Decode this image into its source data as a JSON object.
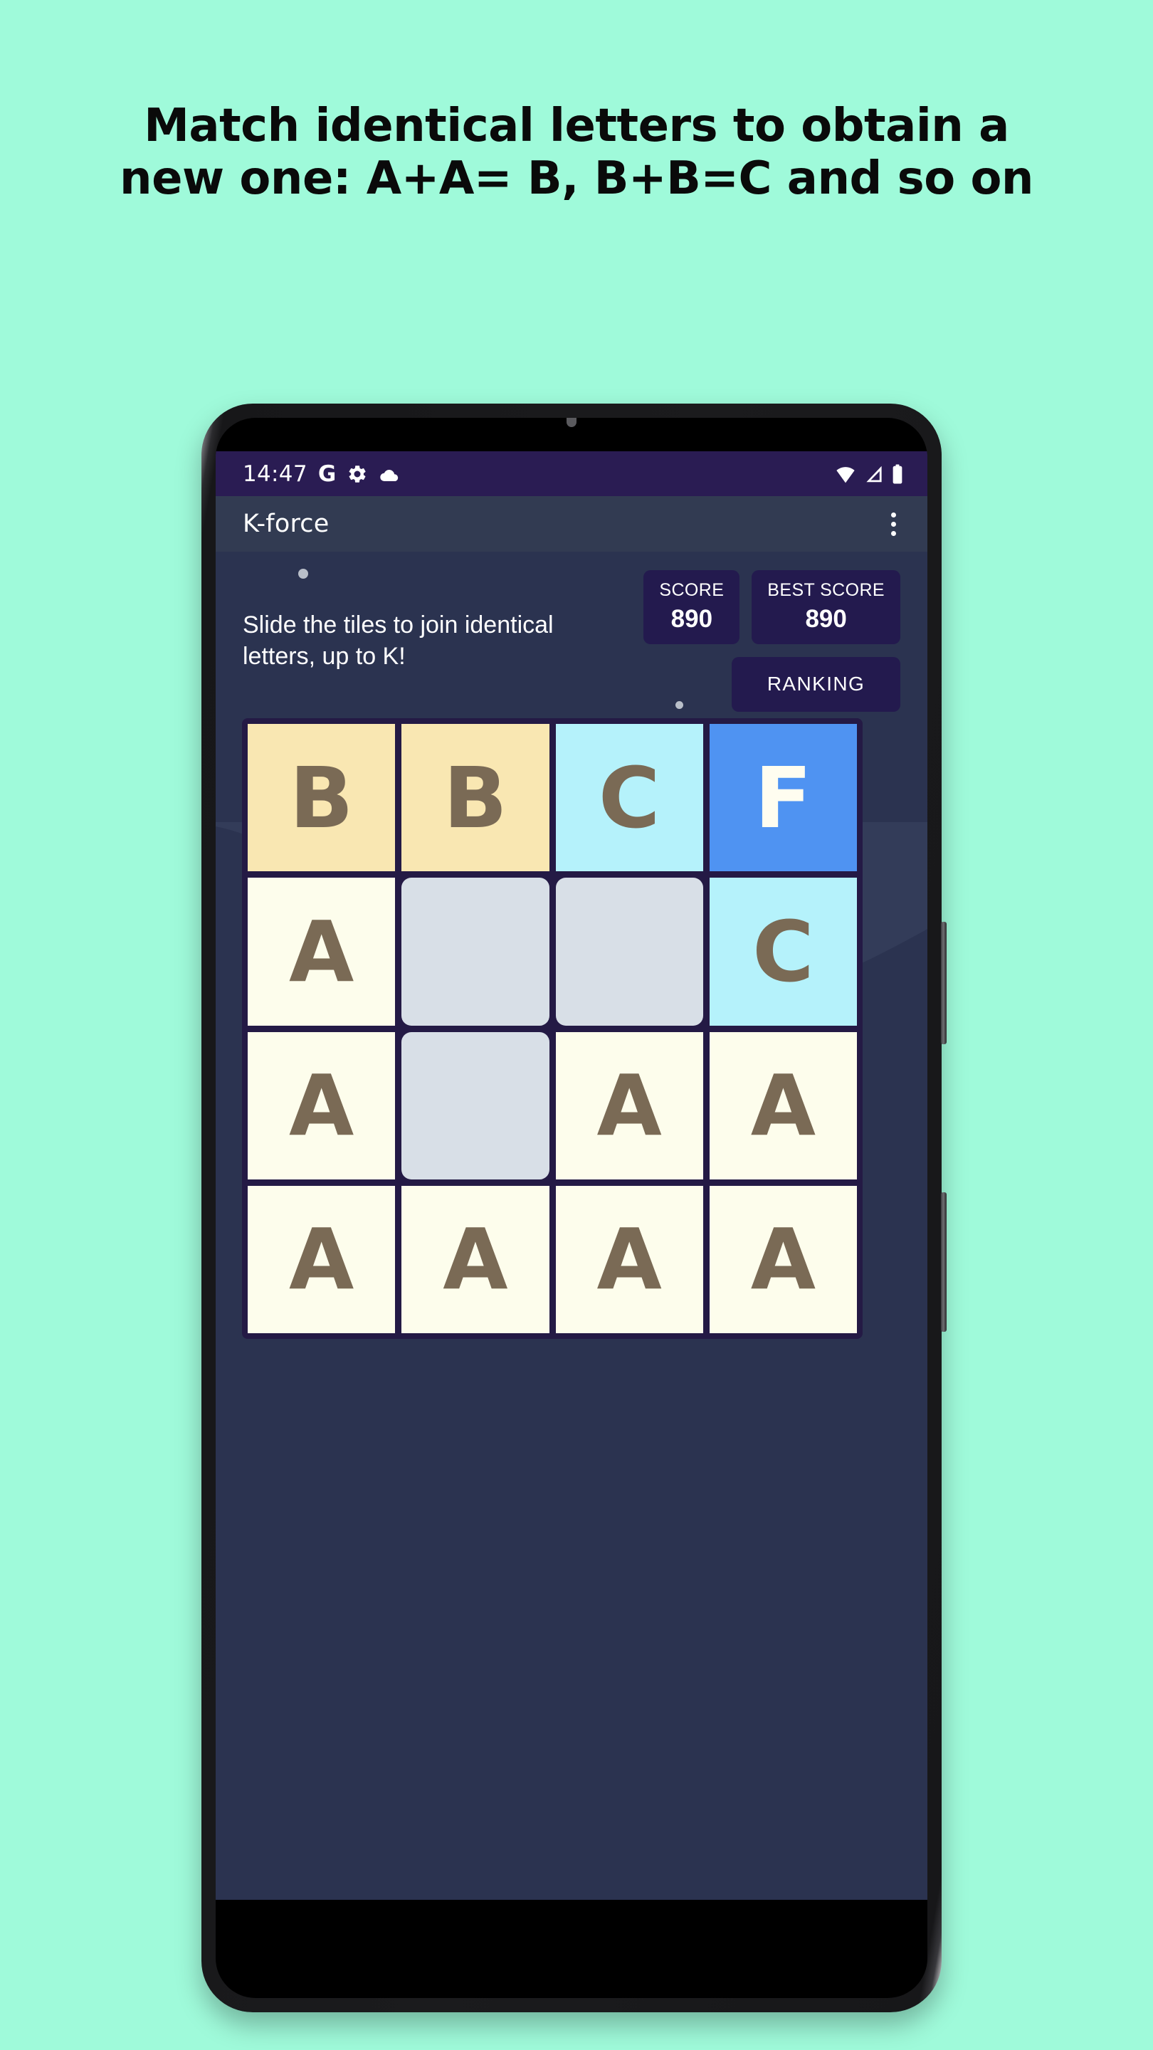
{
  "promo": {
    "line1": "Match identical letters to obtain a",
    "line2": "new one: A+A= B, B+B=C and so on",
    "background_color": "#9ffada",
    "text_color": "#0a0a0a"
  },
  "statusbar": {
    "time": "14:47",
    "google_glyph": "G",
    "icons_left": [
      "google-icon",
      "gear-icon",
      "cloud-icon"
    ],
    "icons_right": [
      "wifi-icon",
      "cellular-signal-icon",
      "battery-icon"
    ],
    "background_color": "#2a1c53"
  },
  "appbar": {
    "title": "K-force",
    "overflow_icon": "kebab-menu-icon",
    "background_color": "#323b52"
  },
  "main": {
    "instructions": "Slide the tiles to join identical letters, up to K!",
    "score": {
      "label": "SCORE",
      "value": "890"
    },
    "best_score": {
      "label": "BEST SCORE",
      "value": "890"
    },
    "ranking_button": "RANKING",
    "panel_color": "#2b3350",
    "score_box_color": "#231a4e"
  },
  "chart_data": {
    "type": "table",
    "title": "K-force 4x4 letter grid",
    "grid_background": "#241a45",
    "rows": 4,
    "cols": 4,
    "tiles": [
      {
        "letter": "B",
        "bg": "#f9e7b2",
        "fg": "#7a6a55"
      },
      {
        "letter": "B",
        "bg": "#f9e7b2",
        "fg": "#7a6a55"
      },
      {
        "letter": "C",
        "bg": "#b5f2fb",
        "fg": "#7a6a55"
      },
      {
        "letter": "F",
        "bg": "#4f93f2",
        "fg": "#fffdf0"
      },
      {
        "letter": "A",
        "bg": "#fdfdec",
        "fg": "#7a6a55"
      },
      {
        "letter": "",
        "bg": "#d8dfe7",
        "fg": "#d8dfe7"
      },
      {
        "letter": "",
        "bg": "#d8dfe7",
        "fg": "#d8dfe7"
      },
      {
        "letter": "C",
        "bg": "#b5f2fb",
        "fg": "#7a6a55"
      },
      {
        "letter": "A",
        "bg": "#fdfdec",
        "fg": "#7a6a55"
      },
      {
        "letter": "",
        "bg": "#d8dfe7",
        "fg": "#d8dfe7"
      },
      {
        "letter": "A",
        "bg": "#fdfdec",
        "fg": "#7a6a55"
      },
      {
        "letter": "A",
        "bg": "#fdfdec",
        "fg": "#7a6a55"
      },
      {
        "letter": "A",
        "bg": "#fdfdec",
        "fg": "#7a6a55"
      },
      {
        "letter": "A",
        "bg": "#fdfdec",
        "fg": "#7a6a55"
      },
      {
        "letter": "A",
        "bg": "#fdfdec",
        "fg": "#7a6a55"
      },
      {
        "letter": "A",
        "bg": "#fdfdec",
        "fg": "#7a6a55"
      }
    ]
  },
  "navigation": {
    "home_indicator": "home-indicator-pill"
  }
}
